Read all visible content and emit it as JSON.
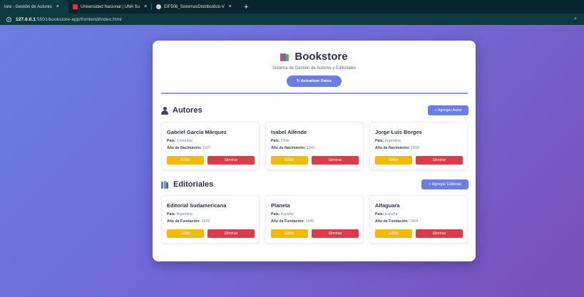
{
  "browser": {
    "tabs": [
      {
        "title": "tore - Gestión de Autores",
        "favicon_color": "#4b6bd8",
        "active": true
      },
      {
        "title": "Universidad Nacional | UNA Su",
        "favicon_color": "#e0323c",
        "active": false
      },
      {
        "title": "EIF508_SistemasDistribuidos-V",
        "favicon_color": "#d0d6d8",
        "active": false
      }
    ],
    "close_glyph": "×",
    "new_tab_glyph": "+",
    "url_host": "127.0.0.1",
    "url_rest": ":5501/bookstore-app/frontend/index.html"
  },
  "header": {
    "title": "Bookstore",
    "subtitle": "Sistema de Gestión de Autores y Editoriales",
    "refresh_label": "↻ Actualizar Datos"
  },
  "autores": {
    "section_title": "Autores",
    "add_label": "+ Agregar Autor",
    "field1_label": "País:",
    "field2_label": "Año de Nacimiento:",
    "items": [
      {
        "name": "Gabriel García Márquez",
        "pais": "Colombia",
        "anio": "1927"
      },
      {
        "name": "Isabel Allende",
        "pais": "Chile",
        "anio": "1942"
      },
      {
        "name": "Jorge Luis Borges",
        "pais": "Argentina",
        "anio": "1899"
      }
    ]
  },
  "editoriales": {
    "section_title": "Editoriales",
    "add_label": "+ Agregar Editorial",
    "field1_label": "País:",
    "field2_label": "Año de Fundación:",
    "items": [
      {
        "name": "Editorial Sudamericana",
        "pais": "Argentina",
        "anio": "1939"
      },
      {
        "name": "Planeta",
        "pais": "España",
        "anio": "1949"
      },
      {
        "name": "Alfaguara",
        "pais": "España",
        "anio": "1964"
      }
    ]
  },
  "actions": {
    "edit_label": "Editar",
    "delete_label": "Eliminar"
  },
  "colors": {
    "accent": "#6a7ee6",
    "edit": "#f5b90a",
    "delete": "#df3a4a"
  }
}
